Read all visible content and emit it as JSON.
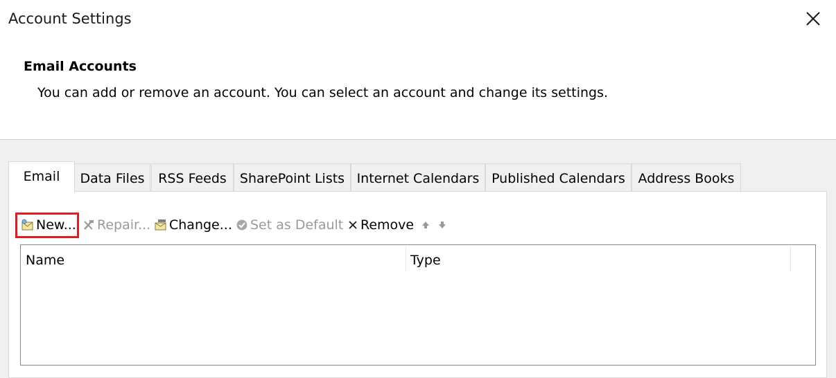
{
  "dialog": {
    "title": "Account Settings",
    "close_glyph": "×"
  },
  "section": {
    "heading": "Email Accounts",
    "description": "You can add or remove an account. You can select an account and change its settings."
  },
  "tabs": [
    {
      "label": "Email",
      "active": true
    },
    {
      "label": "Data Files",
      "active": false
    },
    {
      "label": "RSS Feeds",
      "active": false
    },
    {
      "label": "SharePoint Lists",
      "active": false
    },
    {
      "label": "Internet Calendars",
      "active": false
    },
    {
      "label": "Published Calendars",
      "active": false
    },
    {
      "label": "Address Books",
      "active": false
    }
  ],
  "toolbar": {
    "new_label": "New...",
    "repair_label": "Repair...",
    "change_label": "Change...",
    "set_default_label": "Set as Default",
    "remove_label": "Remove",
    "new_icon": "new-account-icon",
    "repair_icon": "repair-tools-icon",
    "change_icon": "change-account-icon",
    "set_default_icon": "check-circle-icon",
    "remove_icon": "x-icon",
    "move_up_icon": "arrow-up-icon",
    "move_down_icon": "arrow-down-icon",
    "repair_enabled": false,
    "set_default_enabled": false,
    "highlighted_button": "New..."
  },
  "accounts_list": {
    "columns": [
      "Name",
      "Type"
    ],
    "rows": []
  },
  "colors": {
    "highlight_border": "#e31b23",
    "disabled_text": "#9a9a9a",
    "dialog_background": "#f0f0f0"
  }
}
